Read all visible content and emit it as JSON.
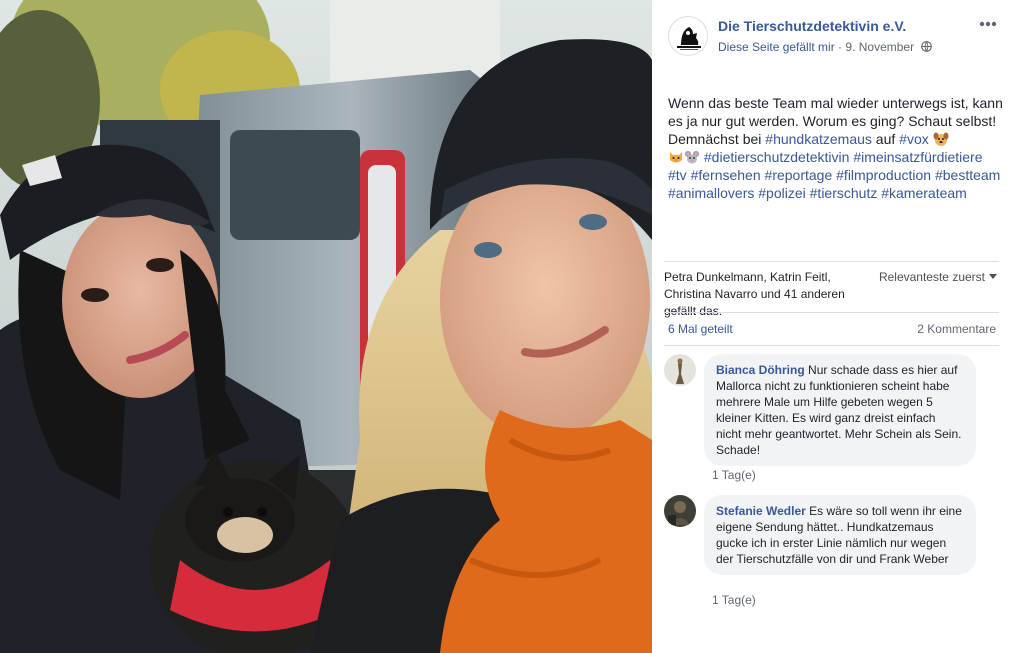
{
  "post": {
    "page_name": "Die Tierschutzdetektivin e.V.",
    "liked_text": "Diese Seite gefällt mir",
    "separator": " · ",
    "date": "9. November",
    "text_parts": [
      {
        "t": "Wenn das beste Team mal wieder unterwegs ist, kann es ja nur gut werden. Worum es ging? Schaut selbst! Demnächst bei ",
        "tag": false
      },
      {
        "t": "#hundkatzemaus",
        "tag": true
      },
      {
        "t": " auf ",
        "tag": false
      },
      {
        "t": "#vox",
        "tag": true
      }
    ],
    "text_parts_2": [
      {
        "t": "#dietierschutzdetektivin",
        "tag": true
      },
      {
        "t": " ",
        "tag": false
      },
      {
        "t": "#imeinsatzfürdietiere",
        "tag": true
      },
      {
        "t": " ",
        "tag": false
      },
      {
        "t": "#tv",
        "tag": true
      },
      {
        "t": " ",
        "tag": false
      },
      {
        "t": "#fernsehen",
        "tag": true
      },
      {
        "t": " ",
        "tag": false
      },
      {
        "t": "#reportage",
        "tag": true
      },
      {
        "t": " ",
        "tag": false
      },
      {
        "t": "#filmproduction",
        "tag": true
      },
      {
        "t": " ",
        "tag": false
      },
      {
        "t": "#bestteam",
        "tag": true
      },
      {
        "t": " ",
        "tag": false
      },
      {
        "t": "#animallovers",
        "tag": true
      },
      {
        "t": " ",
        "tag": false
      },
      {
        "t": "#polizei",
        "tag": true
      },
      {
        "t": " ",
        "tag": false
      },
      {
        "t": "#tierschutz",
        "tag": true
      },
      {
        "t": " ",
        "tag": false
      },
      {
        "t": "#kamerateam",
        "tag": true
      }
    ],
    "emojis": [
      "dog-face-icon",
      "cat-face-icon",
      "mouse-face-icon"
    ]
  },
  "reactions": {
    "likes_text": "Petra Dunkelmann, Katrin Feitl, Christina Navarro und 41 anderen gefällt das.",
    "sort_label": "Relevanteste zuerst",
    "shares": "6 Mal geteilt",
    "comments_count": "2 Kommentare"
  },
  "comments": [
    {
      "author": "Bianca Döhring",
      "text": " Nur schade dass es hier auf Mallorca nicht zu funktionieren scheint habe mehrere Male um Hilfe gebeten wegen 5 kleiner Kitten. Es wird ganz dreist einfach nicht mehr geantwortet. Mehr Schein als Sein. Schade!",
      "time": "1 Tag(e)"
    },
    {
      "author": "Stefanie Wedler",
      "text": " Es wäre so toll wenn ihr eine eigene Sendung hättet.. Hundkatzemaus gucke ich in erster Linie nämlich nur wegen der Tierschutzfälle von dir und Frank Weber",
      "time": "1 Tag(e)"
    }
  ],
  "colors": {
    "link": "#385898",
    "secondary": "#606770",
    "bubble": "#f2f3f5",
    "divider": "#dadde1"
  }
}
